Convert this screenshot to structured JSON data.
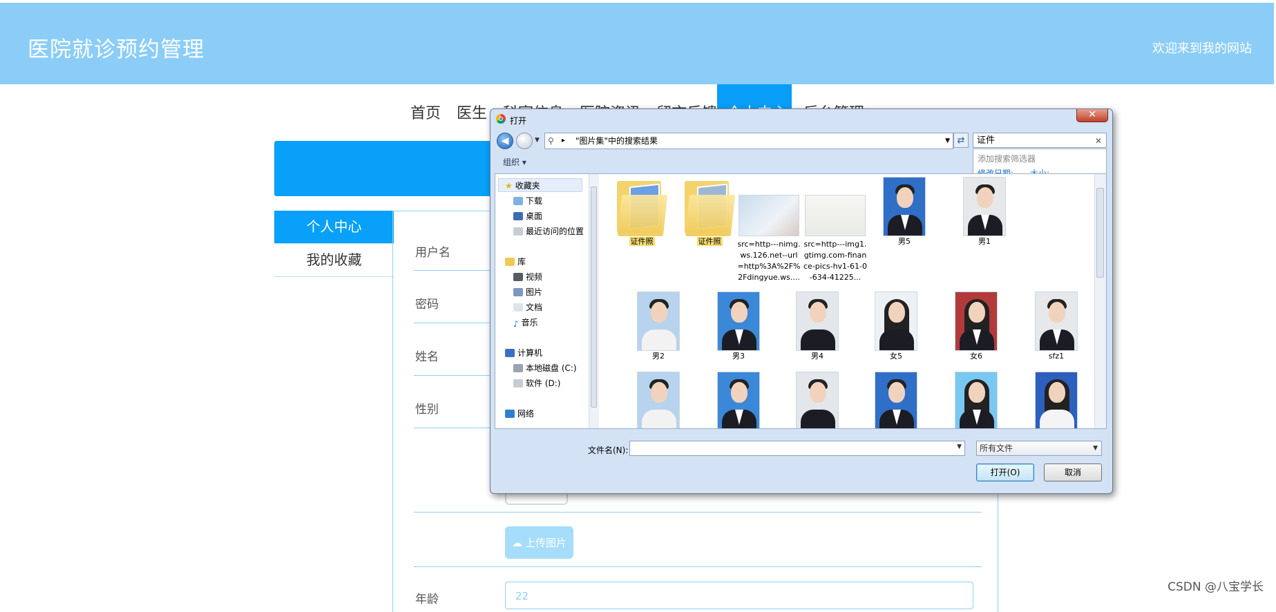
{
  "site": {
    "title": "医院就诊预约管理",
    "welcome": "欢迎来到我的网站",
    "nav": [
      "首页",
      "医生",
      "科室信息",
      "医院资讯",
      "留言反馈"
    ],
    "nav_active": "个人中心",
    "nav_last": "后台管理",
    "side_menu": [
      {
        "label": "个人中心",
        "active": true
      },
      {
        "label": "我的收藏",
        "active": false
      }
    ],
    "form_labels": {
      "username": "用户名",
      "password": "密码",
      "name": "姓名",
      "gender": "性别",
      "age": "年龄"
    },
    "upload_label": "上传图片",
    "age_value": "22",
    "watermark": "CSDN @八宝学长",
    "accent_color": "#08a0f8",
    "header_color": "#8ccdf8"
  },
  "dialog": {
    "title": "打开",
    "address_text": "\"图片集\"中的搜索结果",
    "search_value": "证件",
    "filter_popup": {
      "add_filter": "添加搜索筛选器",
      "date_modified": "修改日期:",
      "size": "大小:"
    },
    "organize_label": "组织 ▾",
    "tree": {
      "favorites": "收藏夹",
      "downloads": "下载",
      "desktop": "桌面",
      "recent": "最近访问的位置",
      "libraries": "库",
      "videos": "视频",
      "pictures": "图片",
      "documents": "文档",
      "music": "音乐",
      "computer": "计算机",
      "drive_c": "本地磁盘 (C:)",
      "drive_d": "软件 (D:)",
      "network": "网络"
    },
    "items_row1": [
      {
        "type": "folder",
        "label": "证件照"
      },
      {
        "type": "folder",
        "label": "证件照"
      },
      {
        "type": "idcard",
        "label": "src=http---nimg.ws.126.net--url=http%3A%2F%2Fdingyue.ws...."
      },
      {
        "type": "idcard2",
        "label": "src=http---img1.gtimg.com-finance-pics-hv1-61-0-634-41225..."
      },
      {
        "type": "photo",
        "label": "男5",
        "bg": "#2f6fc8"
      },
      {
        "type": "photo",
        "label": "男1",
        "bg": "#e6e8ea"
      }
    ],
    "items_row2": [
      {
        "label": "男2",
        "bg": "#b7d3ee"
      },
      {
        "label": "男3",
        "bg": "#3b88d8"
      },
      {
        "label": "男4",
        "bg": "#e3e6ea"
      },
      {
        "label": "女5",
        "bg": "#eef1f4"
      },
      {
        "label": "女6",
        "bg": "#b23a3a"
      },
      {
        "label": "sfz1",
        "bg": "#e6e8ea"
      }
    ],
    "items_row3": [
      {
        "label": "",
        "bg": "#b7d3ee"
      },
      {
        "label": "",
        "bg": "#3b88d8"
      },
      {
        "label": "",
        "bg": "#e3e6ea"
      },
      {
        "label": "",
        "bg": "#2f6fc8"
      },
      {
        "label": "",
        "bg": "#79c8f2"
      },
      {
        "label": "",
        "bg": "#2d5fbf"
      }
    ],
    "filename_label": "文件名(N):",
    "filetype": "所有文件",
    "open_button": "打开(O)",
    "cancel_button": "取消"
  }
}
